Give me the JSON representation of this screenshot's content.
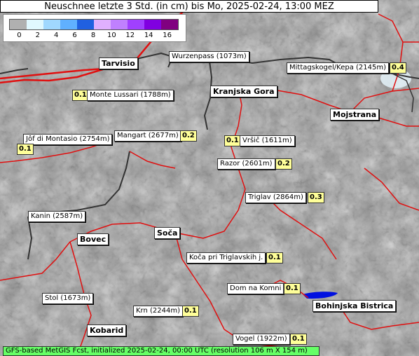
{
  "title": "Neuschnee letzte 3 Std. (in cm) bis Mo, 2025-02-24, 13:00 MEZ",
  "legend": {
    "ticks": [
      "0",
      "2",
      "4",
      "6",
      "8",
      "10",
      "12",
      "14",
      "16"
    ],
    "colors": [
      "#b0b0b0",
      "#e0f8ff",
      "#a0d8ff",
      "#60b0ff",
      "#2060e0",
      "#e0b0ff",
      "#c080ff",
      "#a040ff",
      "#8000e0",
      "#800080"
    ]
  },
  "towns": [
    {
      "name": "Tarvisio"
    },
    {
      "name": "Kranjska Gora"
    },
    {
      "name": "Mojstrana"
    },
    {
      "name": "Bovec"
    },
    {
      "name": "Soča"
    },
    {
      "name": "Bohinjska Bistrica"
    },
    {
      "name": "Kobarid"
    }
  ],
  "peaks": [
    {
      "name": "Wurzenpass (1073m)",
      "value": ""
    },
    {
      "name": "Mittagskogel/Kepa (2145m)",
      "value": "0.4"
    },
    {
      "name": "Monte Lussari (1788m)",
      "value": "0.1"
    },
    {
      "name": "Jôf di Montasio (2754m)",
      "value": "0.1"
    },
    {
      "name": "Mangart (2677m)",
      "value": "0.2"
    },
    {
      "name": "Vršič (1611m)",
      "value": "0.1"
    },
    {
      "name": "Razor (2601m)",
      "value": "0.2"
    },
    {
      "name": "Triglav (2864m)",
      "value": "0.3"
    },
    {
      "name": "Kanin (2587m)",
      "value": ""
    },
    {
      "name": "Koča pri Triglavskih j.",
      "value": "0.1"
    },
    {
      "name": "Dom na Komni",
      "value": "0.1"
    },
    {
      "name": "Stol (1673m)",
      "value": ""
    },
    {
      "name": "Krn (2244m)",
      "value": "0.1"
    },
    {
      "name": "Vogel (1922m)",
      "value": "0.1"
    }
  ],
  "footer": "GFS-based MetGIS Fcst, initialized 2025-02-24, 00:00 UTC  (resolution 106 m X 154 m)"
}
